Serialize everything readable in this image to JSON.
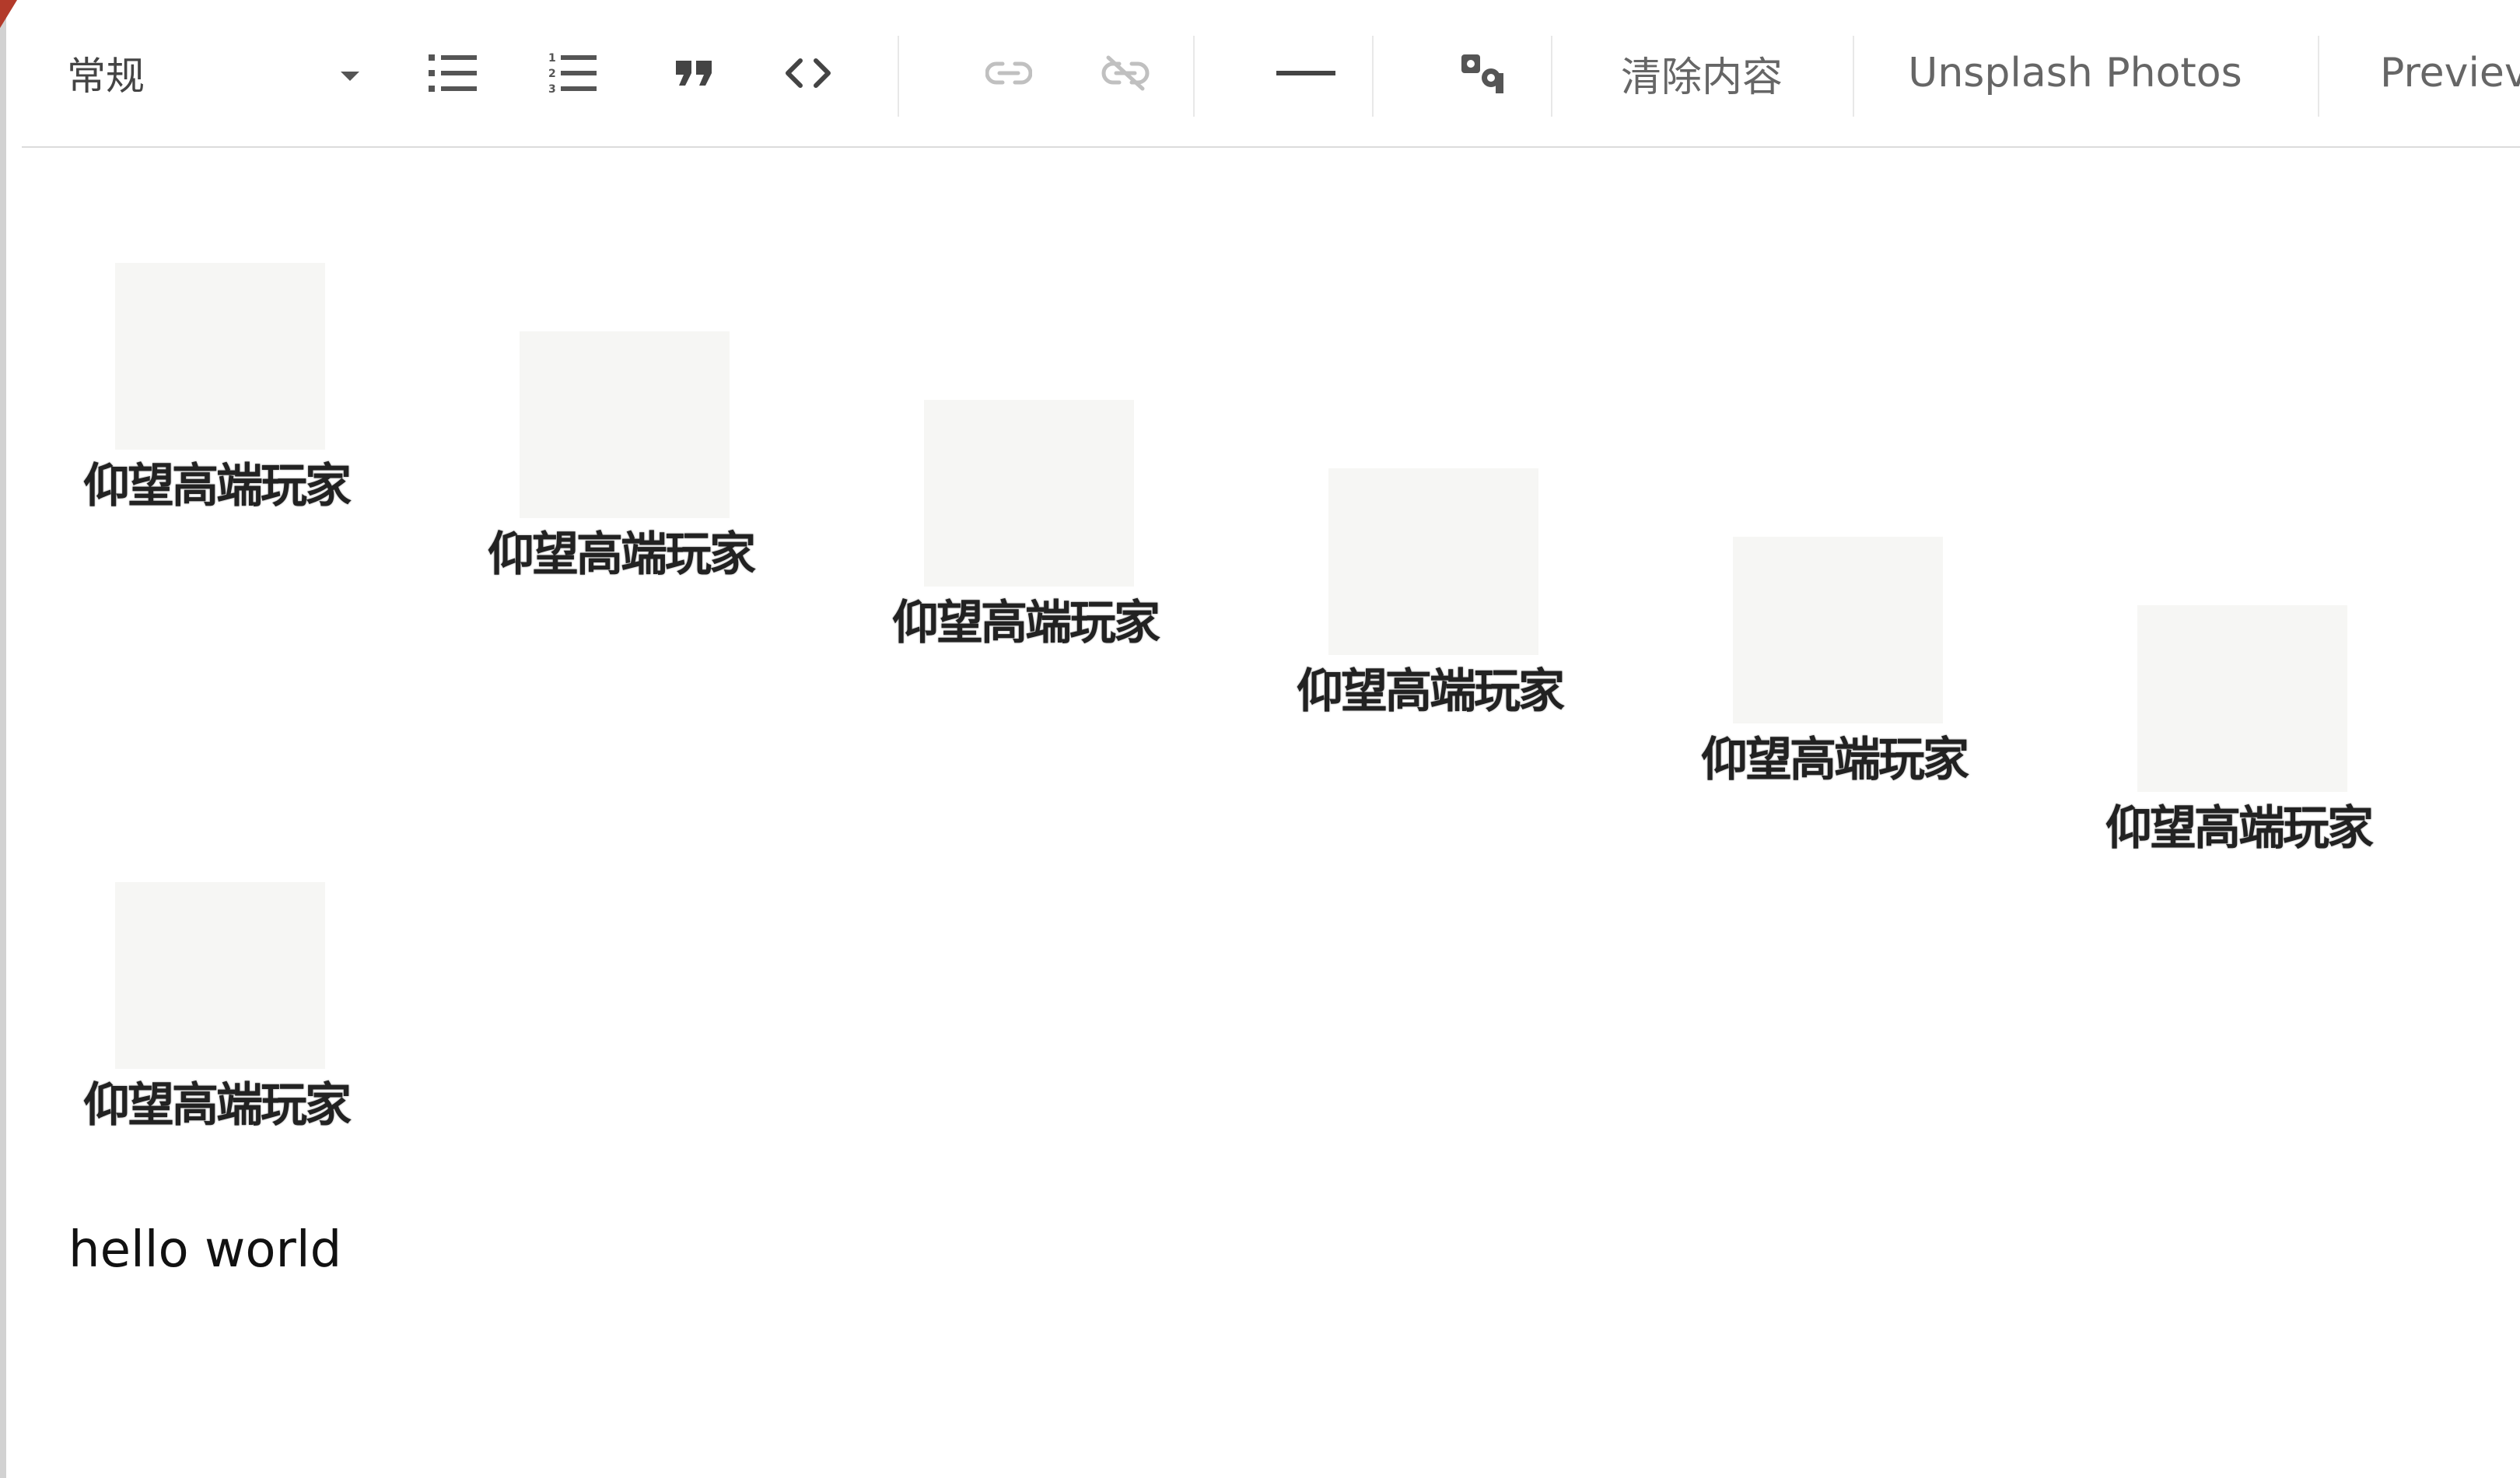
{
  "toolbar": {
    "format_label": "常规",
    "bulleted_list_icon": "bulleted-list-icon",
    "numbered_list_icon": "numbered-list-icon",
    "quote_icon": "quote-icon",
    "code_icon": "code-icon",
    "link_icon": "link-icon",
    "unlink_icon": "unlink-icon",
    "horizontal_rule_icon": "horizontal-rule-icon",
    "image_icon": "image-icon",
    "clear_label": "清除内容",
    "unsplash_label": "Unsplash Photos",
    "preview_label": "Previev"
  },
  "content": {
    "stickers": [
      {
        "caption": "仰望高端玩家"
      },
      {
        "caption": "仰望高端玩家"
      },
      {
        "caption": "仰望高端玩家"
      },
      {
        "caption": "仰望高端玩家"
      },
      {
        "caption": "仰望高端玩家"
      },
      {
        "caption": "仰望高端玩家"
      },
      {
        "caption": "仰望高端玩家"
      }
    ],
    "paragraph": "hello world"
  },
  "colors": {
    "toolbar_text": "#5a5a5a",
    "disabled": "#b8b8b8",
    "border": "#dcdcdc",
    "corner": "#b33a2a"
  }
}
